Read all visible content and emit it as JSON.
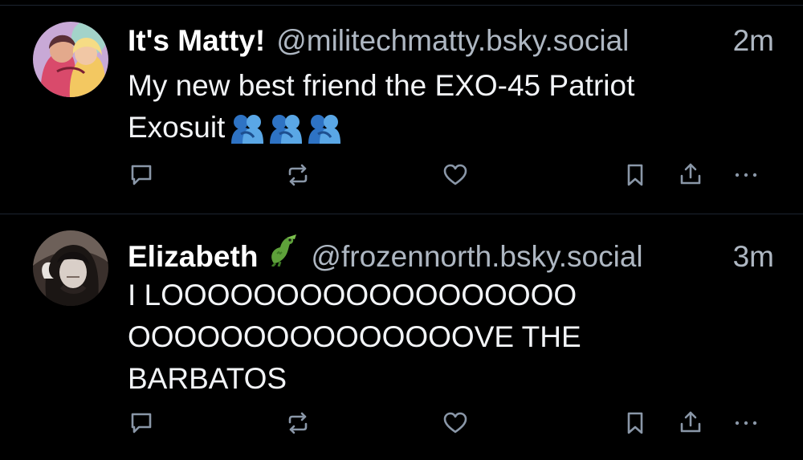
{
  "posts": [
    {
      "display_name": "It's Matty!",
      "handle": "@militechmatty.bsky.social",
      "time": "2m",
      "text": "My new best friend the EXO-45 Patriot\nExosuit",
      "trailing_emoji": [
        "people-hugging",
        "people-hugging",
        "people-hugging"
      ],
      "avatar": "cartoon-couple-avatar"
    },
    {
      "display_name": "Elizabeth",
      "name_emoji": "crocodile",
      "handle": "@frozennorth.bsky.social",
      "time": "3m",
      "text": "I LOOOOOOOOOOOOOOOOOO\nOOOOOOOOOOOOOOOVE THE\nBARBATOS",
      "avatar": "dark-haired-character-avatar"
    }
  ],
  "actions": [
    "reply-icon",
    "repost-icon",
    "like-icon",
    "bookmark-icon",
    "share-icon",
    "more-icon"
  ],
  "colors": {
    "background": "#000000",
    "divider": "#1c2430",
    "handle": "#aeb7c2",
    "icon": "#8a97a8"
  }
}
